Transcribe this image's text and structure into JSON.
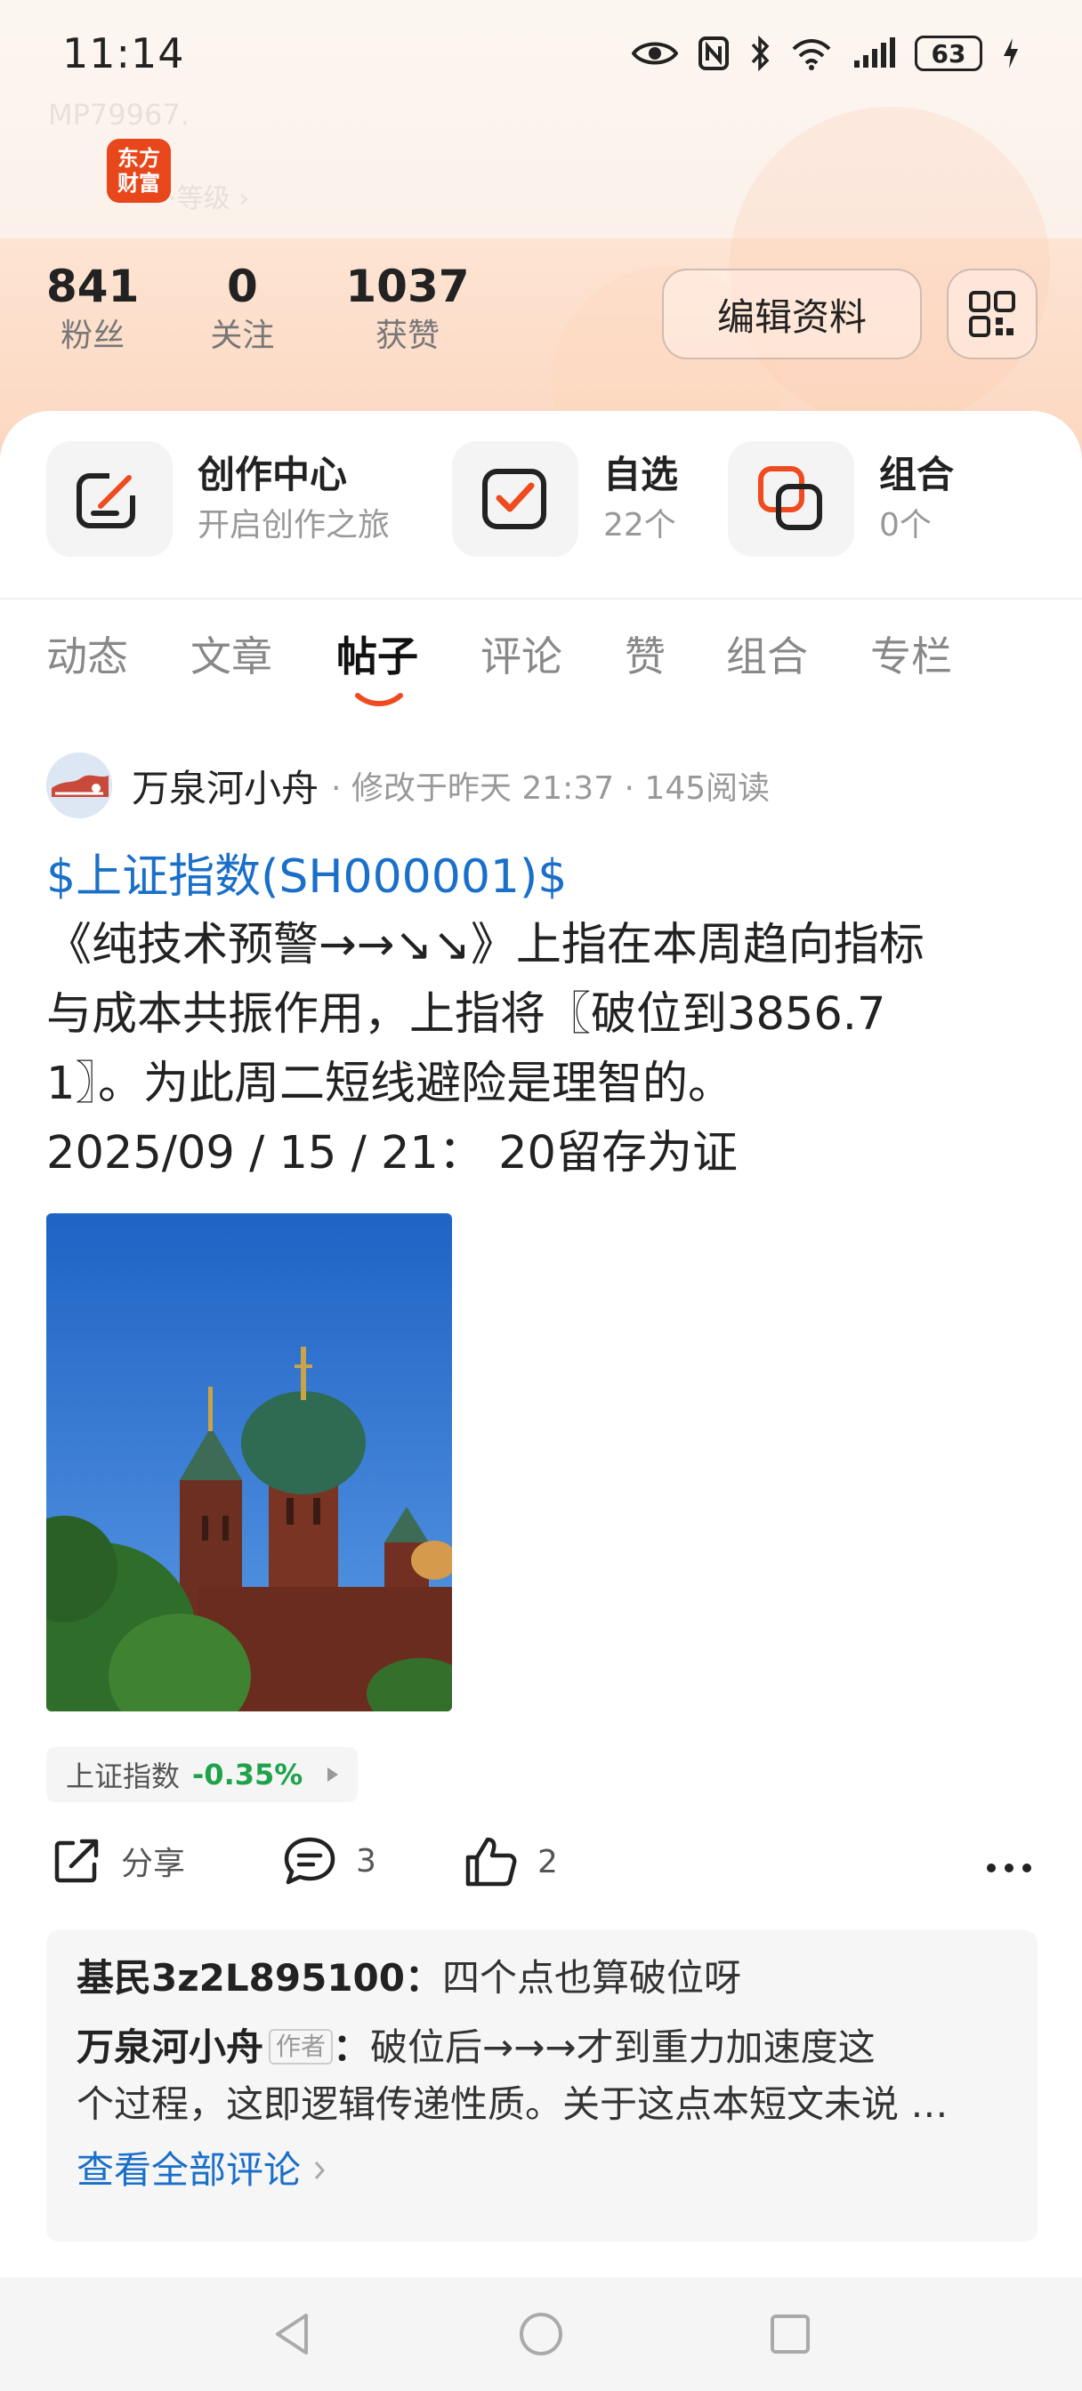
{
  "status_bar": {
    "time": "11:14",
    "battery": "63"
  },
  "header": {
    "faded_user_id": "MP79967.",
    "faded_level": "···等级 ›",
    "logo_line1": "东方",
    "logo_line2": "财富",
    "stats": [
      {
        "value": "841",
        "label": "粉丝"
      },
      {
        "value": "0",
        "label": "关注"
      },
      {
        "value": "1037",
        "label": "获赞"
      }
    ],
    "edit_button": "编辑资料"
  },
  "shortcuts": [
    {
      "title": "创作中心",
      "sub": "开启创作之旅",
      "icon": "edit-square-icon"
    },
    {
      "title": "自选",
      "sub": "22个",
      "icon": "checkbox-icon"
    },
    {
      "title": "组合",
      "sub": "0个",
      "icon": "portfolio-icon"
    }
  ],
  "tabs": [
    "动态",
    "文章",
    "帖子",
    "评论",
    "赞",
    "组合",
    "专栏"
  ],
  "active_tab": "帖子",
  "post": {
    "author": "万泉河小舟",
    "meta": "· 修改于昨天 21:37 · 145阅读",
    "title": "$上证指数(SH000001)$",
    "body_lines": [
      "《纯技术预警→→↘↘》上指在本周趋向指标",
      "与成本共振作用，上指将〖破位到3856.7",
      "1〗。为此周二短线避险是理智的。",
      "2025/09 / 15 / 21： 20留存为证"
    ],
    "stock_tag_name": "上证指数",
    "stock_tag_change": "-0.35%",
    "share_label": "分享",
    "comment_count": "3",
    "like_count": "2"
  },
  "comments": {
    "c1_user": "基民3z2L895100",
    "c1_sep": "：",
    "c1_text": "四个点也算破位呀",
    "c2_user": "万泉河小舟",
    "c2_badge": "作者",
    "c2_sep": "：",
    "c2_text_line1": "破位后→→→才到重力加速度这",
    "c2_text_line2": "个过程，这即逻辑传递性质。关于这点本短文未说 …",
    "view_all": "查看全部评论"
  },
  "colors": {
    "link_blue": "#1a6fc9",
    "accent_orange": "#e8471c",
    "stock_green": "#1fa34a"
  }
}
